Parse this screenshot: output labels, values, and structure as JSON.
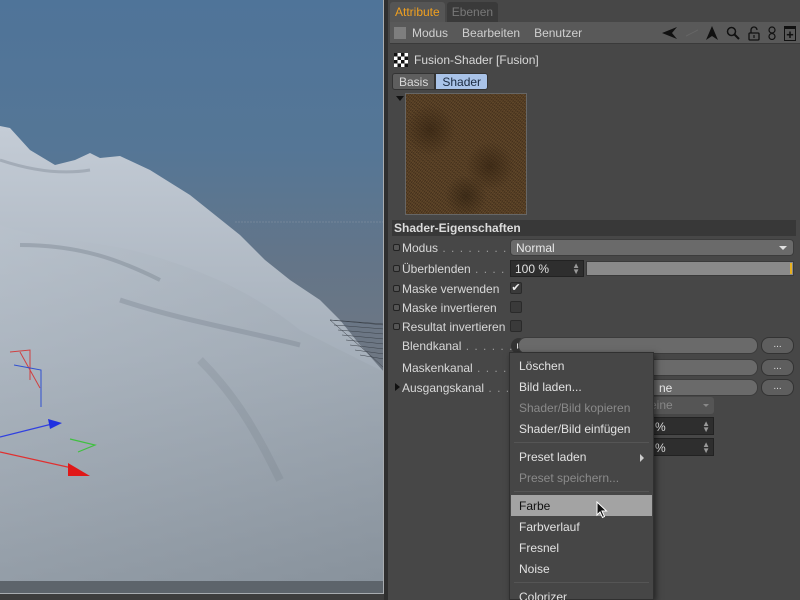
{
  "viewport": {
    "description": "3D viewport showing snowy terrain mesh with axis gizmo"
  },
  "panel": {
    "tabs": [
      {
        "label": "Attribute",
        "active": true
      },
      {
        "label": "Ebenen",
        "active": false
      }
    ],
    "menubar": {
      "items": [
        "Modus",
        "Bearbeiten",
        "Benutzer"
      ],
      "icons": [
        "back-arrow-icon",
        "forward-arrow-icon",
        "search-icon",
        "lock-icon",
        "link-icon",
        "new-panel-icon"
      ]
    },
    "object_title": "Fusion-Shader [Fusion]",
    "subtabs": [
      {
        "label": "Basis",
        "active": false
      },
      {
        "label": "Shader",
        "active": true
      }
    ],
    "section_header": "Shader-Eigenschaften",
    "properties": {
      "modus": {
        "label": "Modus",
        "dots": " . . . . . . . . . . . .",
        "value": "Normal"
      },
      "ueberblenden": {
        "label": "Überblenden",
        "dots": " . . . . . .",
        "value": "100 %",
        "slider_fraction": 1.0,
        "accent": "#e8b020"
      },
      "maske_verwenden": {
        "label": "Maske verwenden",
        "checked": true,
        "check_glyph": "✔"
      },
      "maske_invertieren": {
        "label": "Maske invertieren",
        "checked": false
      },
      "resultat_invertieren": {
        "label": "Resultat invertieren",
        "checked": false
      },
      "blendkanal": {
        "label": "Blendkanal",
        "dots": " . . . . . . . .",
        "ellipsis": "..."
      },
      "maskenkanal": {
        "label": "Maskenkanal",
        "dots": " . . . . . . .",
        "ellipsis": "..."
      },
      "ausgangskanal": {
        "label": "Ausgangskanal",
        "dots": " . . . . .",
        "value_partial": "ne",
        "ellipsis": "..."
      },
      "hidden_dropdown_partial": "eine",
      "hidden_num1_partial": "%",
      "hidden_num2_partial": "%"
    }
  },
  "context_menu": {
    "items": [
      {
        "label": "Löschen",
        "disabled": false
      },
      {
        "label": "Bild laden...",
        "disabled": false
      },
      {
        "label": "Shader/Bild kopieren",
        "disabled": true
      },
      {
        "label": "Shader/Bild einfügen",
        "disabled": false
      },
      {
        "separator": true
      },
      {
        "label": "Preset laden",
        "disabled": false,
        "submenu": true
      },
      {
        "label": "Preset speichern...",
        "disabled": true
      },
      {
        "separator": true
      },
      {
        "label": "Farbe",
        "disabled": false,
        "highlighted": true
      },
      {
        "label": "Farbverlauf",
        "disabled": false
      },
      {
        "label": "Fresnel",
        "disabled": false
      },
      {
        "label": "Noise",
        "disabled": false
      },
      {
        "separator": true
      },
      {
        "label": "Colorizer",
        "disabled": false
      }
    ]
  }
}
